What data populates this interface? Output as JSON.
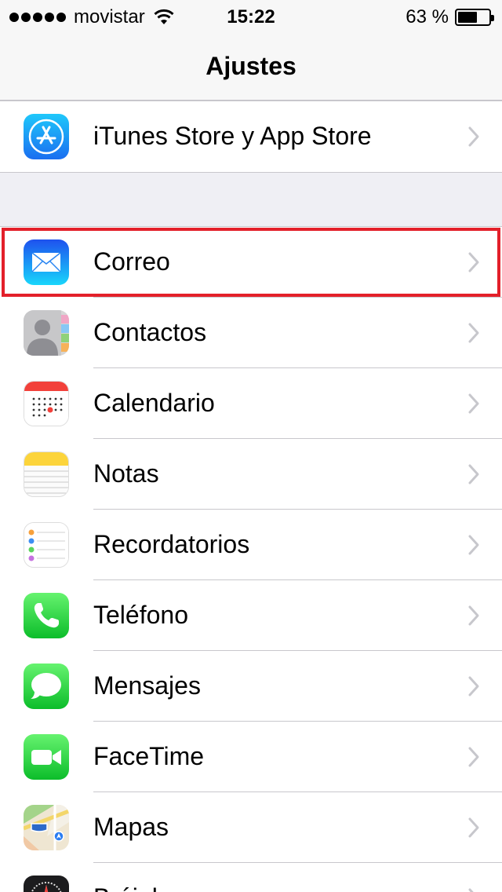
{
  "status_bar": {
    "carrier": "movistar",
    "time": "15:22",
    "battery_percent": "63 %",
    "battery_level": 0.63
  },
  "nav": {
    "title": "Ajustes"
  },
  "group_store": [
    {
      "label": "iTunes Store y App Store",
      "icon": "app-store-icon"
    }
  ],
  "group_apps": [
    {
      "label": "Correo",
      "icon": "mail-icon"
    },
    {
      "label": "Contactos",
      "icon": "contacts-icon"
    },
    {
      "label": "Calendario",
      "icon": "calendar-icon"
    },
    {
      "label": "Notas",
      "icon": "notes-icon"
    },
    {
      "label": "Recordatorios",
      "icon": "reminders-icon"
    },
    {
      "label": "Teléfono",
      "icon": "phone-icon"
    },
    {
      "label": "Mensajes",
      "icon": "messages-icon"
    },
    {
      "label": "FaceTime",
      "icon": "facetime-icon"
    },
    {
      "label": "Mapas",
      "icon": "maps-icon"
    },
    {
      "label": "Brújula",
      "icon": "compass-icon"
    }
  ],
  "colors": {
    "highlight": "#e3202a",
    "background": "#efeff4",
    "separator": "#c8c7cc",
    "chevron": "#c7c7cc"
  }
}
